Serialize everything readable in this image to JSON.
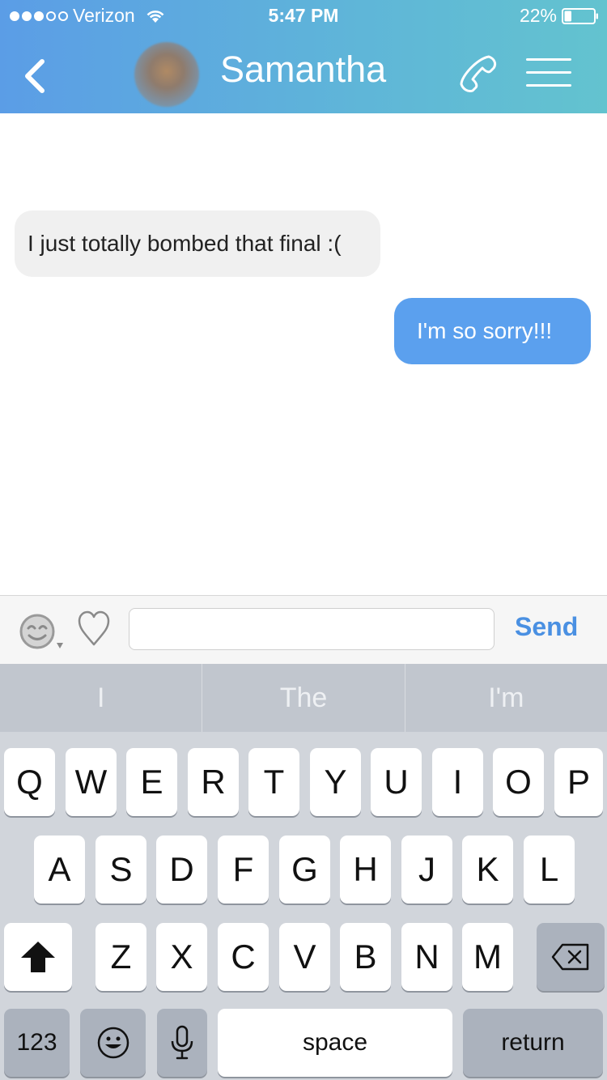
{
  "status_bar": {
    "carrier": "Verizon",
    "time": "5:47 PM",
    "battery": "22%"
  },
  "header": {
    "contact_name": "Samantha",
    "icons": [
      "back-icon",
      "phone-icon",
      "menu-icon"
    ]
  },
  "messages": [
    {
      "direction": "incoming",
      "text": "I just totally bombed that final :("
    },
    {
      "direction": "outgoing",
      "text": "I'm so sorry!!!"
    }
  ],
  "composer": {
    "input_value": "",
    "placeholder": "",
    "send_label": "Send"
  },
  "keyboard": {
    "suggestions": [
      "I",
      "The",
      "I'm"
    ],
    "row1": [
      "Q",
      "W",
      "E",
      "R",
      "T",
      "Y",
      "U",
      "I",
      "O",
      "P"
    ],
    "row2": [
      "A",
      "S",
      "D",
      "F",
      "G",
      "H",
      "J",
      "K",
      "L"
    ],
    "row3": [
      "Z",
      "X",
      "C",
      "V",
      "B",
      "N",
      "M"
    ],
    "numbers_label": "123",
    "space_label": "space",
    "return_label": "return"
  },
  "colors": {
    "header_gradient_start": "#5b9de6",
    "header_gradient_end": "#63c3cf",
    "outgoing_bubble": "#5ba0ee",
    "incoming_bubble": "#f0f0f0",
    "send_text": "#4a90e2"
  }
}
